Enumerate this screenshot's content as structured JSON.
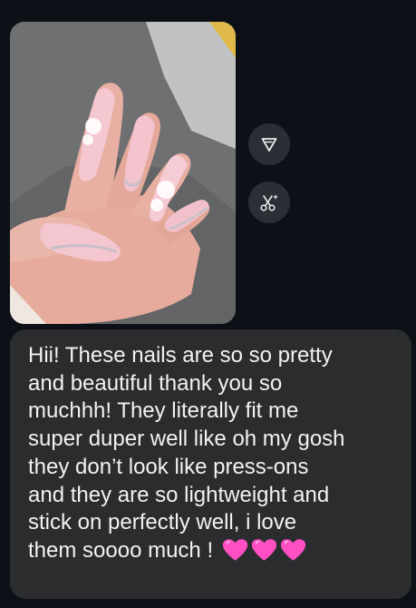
{
  "photo": {
    "alt": "Photo of a hand with long almond-shaped pink press-on nails decorated with white 3D flowers and silver glitter tips",
    "colors": {
      "background": "#6b6c6e",
      "skin": "#e8b0a3",
      "nail": "#f3c9d3",
      "nail_tip": "#fbe6ec",
      "glitter": "#c8c0c8"
    }
  },
  "actions": {
    "share_icon": "send-triangle-icon",
    "remix_icon": "scissors-sparkle-icon"
  },
  "message": {
    "text": "Hii! These nails are so so pretty\nand beautiful thank you so\nmuchhh! They literally fit me\nsuper duper well like oh my gosh\nthey don’t look like press-ons\nand they are so lightweight and\nstick on perfectly well, i love\nthem soooo much ! ",
    "emoji": [
      "pink-heart",
      "pink-heart",
      "pink-heart"
    ],
    "emoji_color": "#ff4fc3"
  },
  "theme": {
    "page_background": "#0d1117",
    "bubble_background": "#2b2c2e",
    "button_background": "#2a2f36",
    "text_color": "#f2f2f2"
  }
}
